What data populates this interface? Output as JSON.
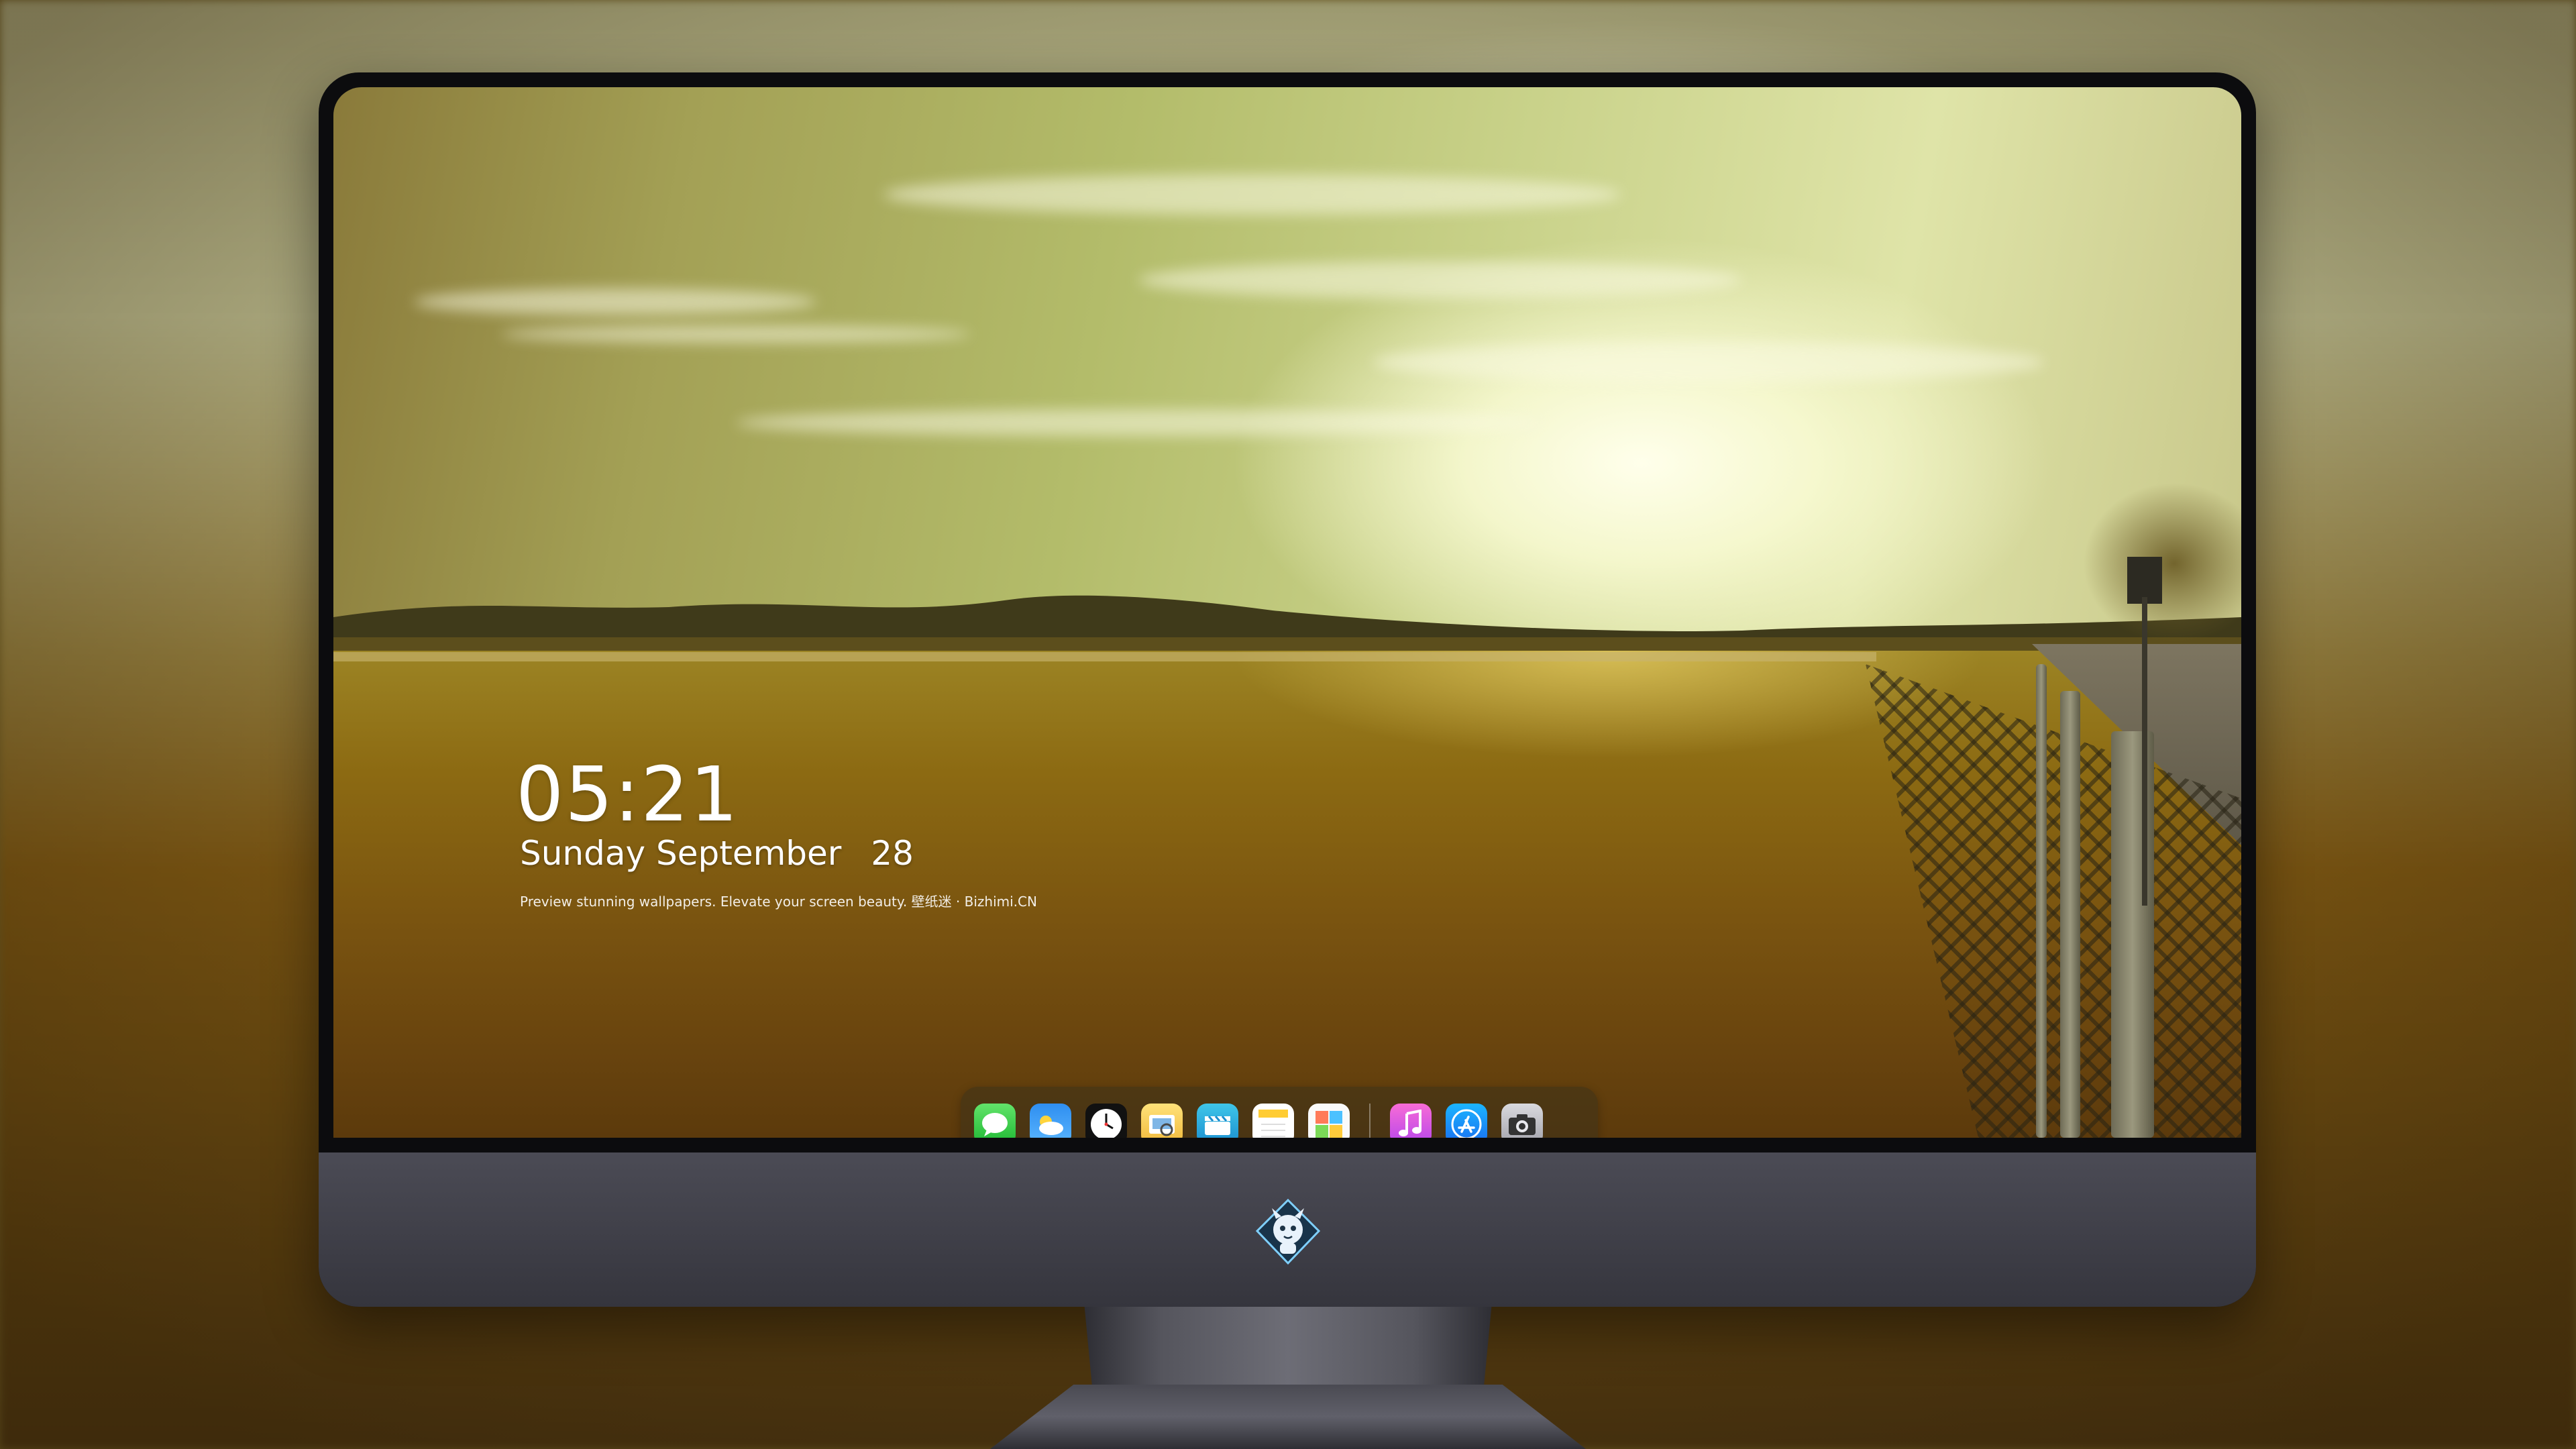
{
  "lockscreen": {
    "time": "05:21",
    "weekday": "Sunday",
    "month": "September",
    "day": "28",
    "tagline": "Preview stunning wallpapers. Elevate your screen beauty. 壁纸迷 · Bizhimi.CN"
  },
  "dock": {
    "apps": [
      {
        "name": "Messages",
        "icon": "message-bubble-icon"
      },
      {
        "name": "Weather",
        "icon": "cloud-icon"
      },
      {
        "name": "Clock",
        "icon": "clock-icon"
      },
      {
        "name": "Preview",
        "icon": "image-viewer-icon"
      },
      {
        "name": "Clips",
        "icon": "clapperboard-icon"
      },
      {
        "name": "Notes",
        "icon": "notes-icon"
      },
      {
        "name": "Gallery",
        "icon": "photo-grid-icon"
      },
      {
        "name": "Music",
        "icon": "music-note-icon"
      },
      {
        "name": "App Store",
        "icon": "app-store-icon"
      },
      {
        "name": "Camera",
        "icon": "camera-icon"
      }
    ]
  },
  "monitor": {
    "logo_icon": "dragon-mascot-icon"
  },
  "colors": {
    "bezel": "#0c0c0e",
    "chin": "#3e3e47",
    "sky_glow": "#f8fad2",
    "field": "#7a5410"
  }
}
